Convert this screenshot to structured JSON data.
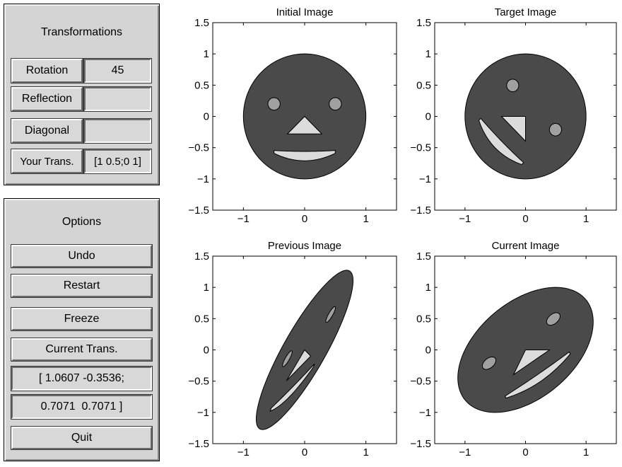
{
  "transformations": {
    "title": "Transformations",
    "rows": [
      {
        "label": "Rotation",
        "value": "45"
      },
      {
        "label": "Reflection",
        "value": ""
      },
      {
        "label": "Diagonal",
        "value": ""
      },
      {
        "label": "Your Trans.",
        "value": "[1 0.5;0 1]"
      }
    ]
  },
  "options": {
    "title": "Options",
    "undo": "Undo",
    "restart": "Restart",
    "freeze": "Freeze",
    "current_trans": "Current Trans.",
    "matrix_row1": "[ 1.0607 -0.3536;",
    "matrix_row2": "0.7071  0.7071 ]",
    "quit": "Quit"
  },
  "colors": {
    "face": "#4a4a4a",
    "features": "#dcdcdc",
    "eyes": "#a0a0a0"
  },
  "plots": [
    {
      "title": "Initial Image",
      "matrix": [
        [
          1,
          0
        ],
        [
          0,
          1
        ]
      ]
    },
    {
      "title": "Target Image",
      "matrix": [
        [
          0.7071,
          0.7071
        ],
        [
          -0.7071,
          0.7071
        ]
      ]
    },
    {
      "title": "Previous Image",
      "matrix": [
        [
          0.7071,
          0.3536
        ],
        [
          0.7071,
          1.0607
        ]
      ]
    },
    {
      "title": "Current Image",
      "matrix": [
        [
          1.0607,
          -0.3536
        ],
        [
          0.7071,
          0.7071
        ]
      ]
    }
  ],
  "axis": {
    "xlim": [
      -1.5,
      1.5
    ],
    "ylim": [
      -1.5,
      1.5
    ],
    "xticks": [
      -1,
      0,
      1
    ],
    "yticks": [
      -1.5,
      -1,
      -0.5,
      0,
      0.5,
      1,
      1.5
    ],
    "xtick_labels": [
      "−1",
      "0",
      "1"
    ],
    "ytick_labels": [
      "−1.5",
      "−1",
      "−0.5",
      "0",
      "0.5",
      "1",
      "1.5"
    ]
  }
}
